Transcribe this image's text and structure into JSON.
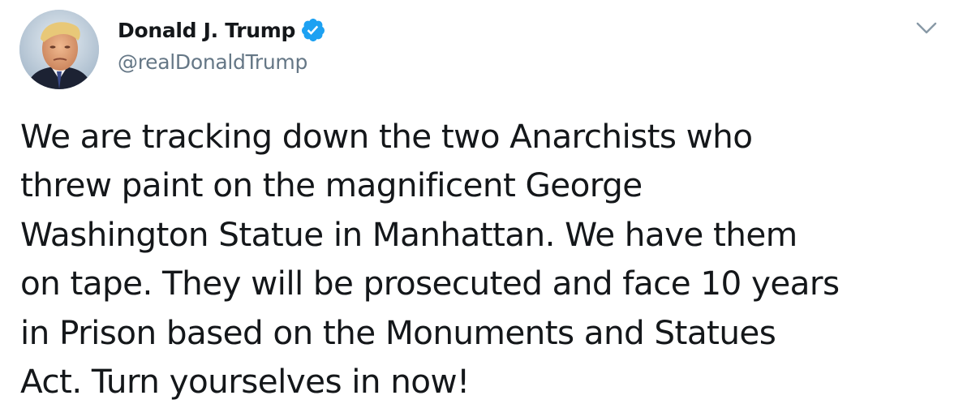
{
  "author": {
    "display_name": "Donald J. Trump",
    "handle": "@realDonaldTrump",
    "verified": true,
    "verified_color": "#1da1f2"
  },
  "tweet": {
    "lines": [
      "We are tracking down the two Anarchists who",
      "threw paint on the magnificent George",
      "Washington Statue in Manhattan. We have them",
      "on tape. They will be prosecuted and face 10 years",
      "in Prison based on the Monuments and Statues",
      "Act. Turn yourselves in now!"
    ]
  },
  "icons": {
    "avatar": "profile-photo",
    "verified": "verified-badge-icon",
    "menu": "chevron-down-icon"
  },
  "colors": {
    "text": "#14171a",
    "secondary_text": "#657786",
    "caret": "#8899a6",
    "background": "#ffffff"
  }
}
